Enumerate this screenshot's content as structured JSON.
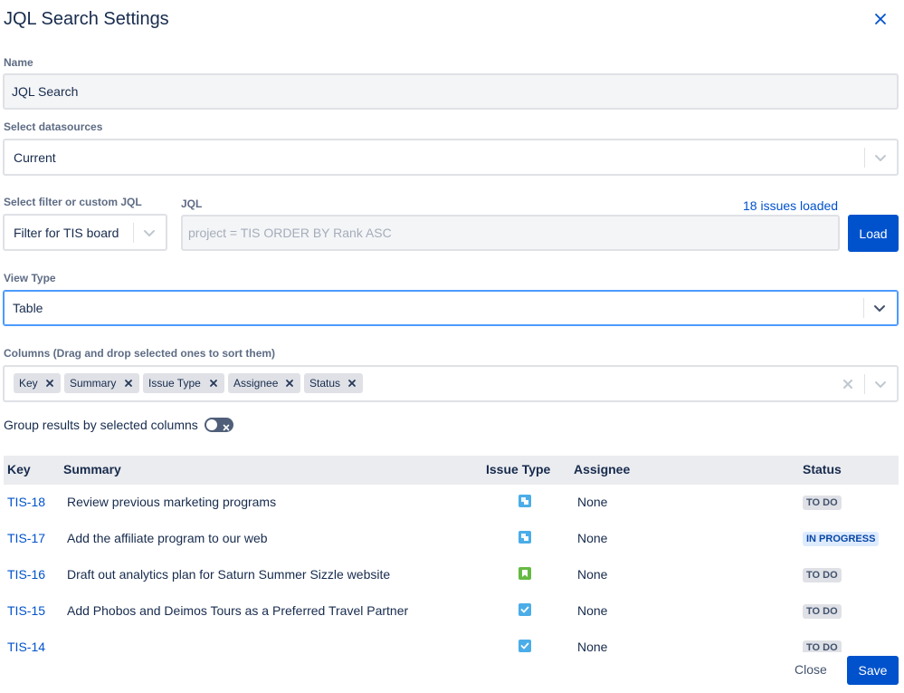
{
  "dialog": {
    "title": "JQL Search Settings"
  },
  "name": {
    "label": "Name",
    "value": "JQL Search"
  },
  "datasources": {
    "label": "Select datasources",
    "value": "Current"
  },
  "filter": {
    "label": "Select filter or custom JQL",
    "value": "Filter for TIS board"
  },
  "jql": {
    "label": "JQL",
    "placeholder": "project = TIS ORDER BY Rank ASC",
    "issues_loaded": "18 issues loaded",
    "load_label": "Load"
  },
  "view_type": {
    "label": "View Type",
    "value": "Table"
  },
  "columns": {
    "label": "Columns (Drag and drop selected ones to sort them)",
    "tags": [
      "Key",
      "Summary",
      "Issue Type",
      "Assignee",
      "Status"
    ]
  },
  "group": {
    "label": "Group results by selected columns",
    "enabled": false
  },
  "table": {
    "headers": [
      "Key",
      "Summary",
      "Issue Type",
      "Assignee",
      "Status"
    ],
    "rows": [
      {
        "key": "TIS-18",
        "summary": "Review previous marketing programs",
        "issue_type": "story-icon",
        "assignee": "None",
        "status": "TO DO"
      },
      {
        "key": "TIS-17",
        "summary": "Add the affiliate program to our web",
        "issue_type": "story-icon",
        "assignee": "None",
        "status": "IN PROGRESS"
      },
      {
        "key": "TIS-16",
        "summary": "Draft out analytics plan for Saturn Summer Sizzle website",
        "issue_type": "bookmark-icon",
        "assignee": "None",
        "status": "TO DO"
      },
      {
        "key": "TIS-15",
        "summary": "Add Phobos and Deimos Tours as a Preferred Travel Partner",
        "issue_type": "task-icon",
        "assignee": "None",
        "status": "TO DO"
      },
      {
        "key": "TIS-14",
        "summary": "",
        "issue_type": "task-icon",
        "assignee": "None",
        "status": "TO DO"
      }
    ]
  },
  "footer": {
    "close_label": "Close",
    "save_label": "Save"
  },
  "colors": {
    "primary": "#0052cc",
    "story": "#4bade8",
    "task": "#4bade8",
    "bookmark": "#65ba43"
  }
}
